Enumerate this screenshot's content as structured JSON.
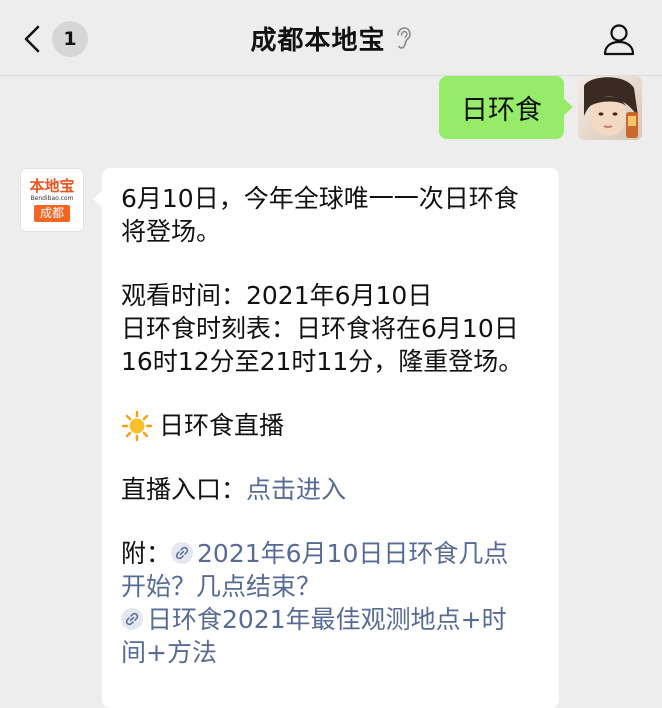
{
  "nav": {
    "back_badge": "1",
    "title": "成都本地宝"
  },
  "messages": {
    "sent": {
      "text": "日环食"
    },
    "received": {
      "avatar_logo_text": "本地宝",
      "avatar_logo_sub": "Bendibao.com",
      "avatar_logo_city": "成都",
      "line1": "6月10日，今年全球唯一一次日环食",
      "line2": "将登场。",
      "line3": "观看时间：2021年6月10日",
      "line4": "日环食时刻表：日环食将在6月10日",
      "line5": "16时12分至21时11分，隆重登场。",
      "live_title": "日环食直播",
      "entry_label": "直播入口：",
      "entry_link": "点击进入",
      "appendix_label": "附：",
      "link1_part1": "2021年6月10日日环食几点",
      "link1_part2": "开始？几点结束？",
      "link2_part1": "日环食2021年最佳观测地点+时",
      "link2_part2": "间+方法"
    }
  },
  "colors": {
    "sent_bubble": "#95ec69",
    "link": "#576b95",
    "background": "#ededed"
  },
  "icons": [
    "back-arrow-icon",
    "mute-ear-icon",
    "profile-icon",
    "sun-icon",
    "link-icon"
  ]
}
